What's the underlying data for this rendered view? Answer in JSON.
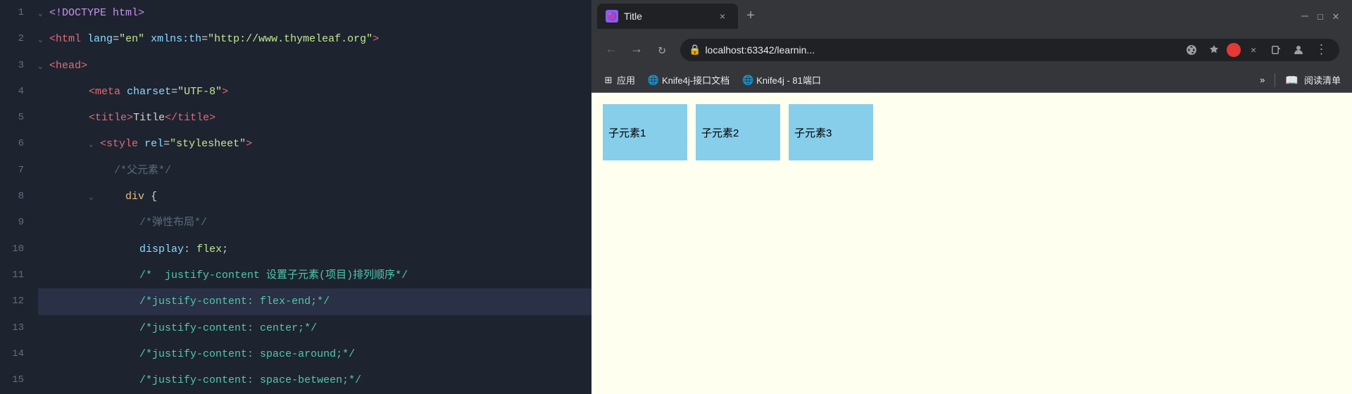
{
  "editor": {
    "lines": [
      {
        "num": 1,
        "content": "<!DOCTYPE html>",
        "tokens": [
          {
            "t": "<!DOCTYPE html>",
            "c": "kw"
          }
        ]
      },
      {
        "num": 2,
        "content": "<html lang=\"en\" xmlns:th=\"http://www.thymeleaf.org\">",
        "tokens": []
      },
      {
        "num": 3,
        "content": "<head>",
        "tokens": []
      },
      {
        "num": 4,
        "content": "    <meta charset=\"UTF-8\">",
        "tokens": []
      },
      {
        "num": 5,
        "content": "    <title>Title</title>",
        "tokens": []
      },
      {
        "num": 6,
        "content": "    <style rel=\"stylesheet\">",
        "tokens": []
      },
      {
        "num": 7,
        "content": "        /*父元素*/",
        "tokens": []
      },
      {
        "num": 8,
        "content": "        div {",
        "tokens": []
      },
      {
        "num": 9,
        "content": "            /*弹性布局*/",
        "tokens": []
      },
      {
        "num": 10,
        "content": "            display: flex;",
        "tokens": []
      },
      {
        "num": 11,
        "content": "            /*  justify-content 设置子元素(项目)排列顺序*/",
        "tokens": []
      },
      {
        "num": 12,
        "content": "            /*justify-content: flex-end;*/",
        "tokens": []
      },
      {
        "num": 13,
        "content": "            /*justify-content: center;*/",
        "tokens": []
      },
      {
        "num": 14,
        "content": "            /*justify-content: space-around;*/",
        "tokens": []
      },
      {
        "num": 15,
        "content": "            /*justify-content: space-between;*/",
        "tokens": []
      }
    ]
  },
  "browser": {
    "tab": {
      "favicon": "🟣",
      "title": "Title",
      "close": "×"
    },
    "new_tab_icon": "+",
    "window_controls": {
      "minimize": "—",
      "maximize": "☐",
      "close": "✕"
    },
    "nav": {
      "back": "←",
      "forward": "→",
      "refresh": "↻"
    },
    "address": "localhost:63342/learnin...",
    "bookmarks": [
      {
        "icon": "⊞",
        "label": "应用"
      },
      {
        "icon": "🌐",
        "label": "Knife4j-接口文档"
      },
      {
        "icon": "🌐",
        "label": "Knife4j - 81端口"
      }
    ],
    "bookmarks_more": "»",
    "bookmarks_reading": "阅读清单",
    "page": {
      "children": [
        {
          "label": "子元素1"
        },
        {
          "label": "子元素2"
        },
        {
          "label": "子元素3"
        }
      ]
    }
  }
}
